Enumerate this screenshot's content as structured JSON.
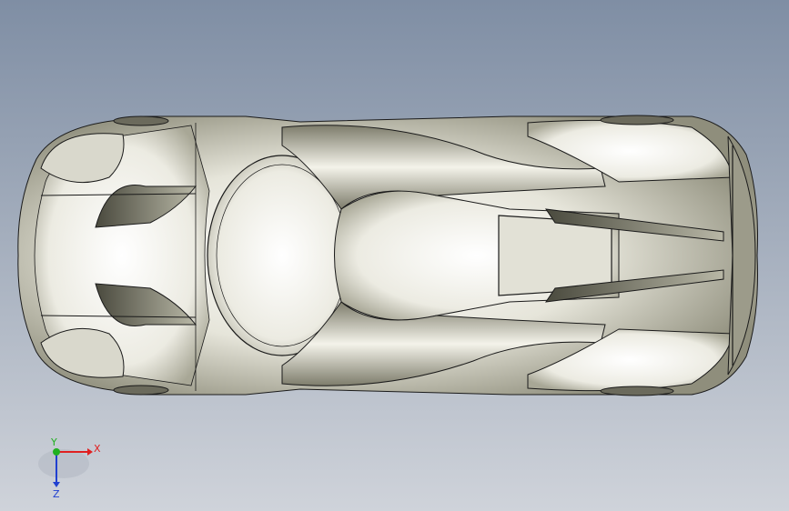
{
  "viewport": {
    "background_top": "#7f8ea4",
    "background_bottom": "#cfd3da"
  },
  "model": {
    "body_color": "#e8e7dc",
    "shadow_color": "#8c8b7a",
    "edge_color": "#1a1a1a"
  },
  "triad": {
    "x_label": "X",
    "y_label": "Y",
    "z_label": "Z",
    "x_color": "#e02020",
    "y_color": "#20b020",
    "z_color": "#2040d0"
  }
}
